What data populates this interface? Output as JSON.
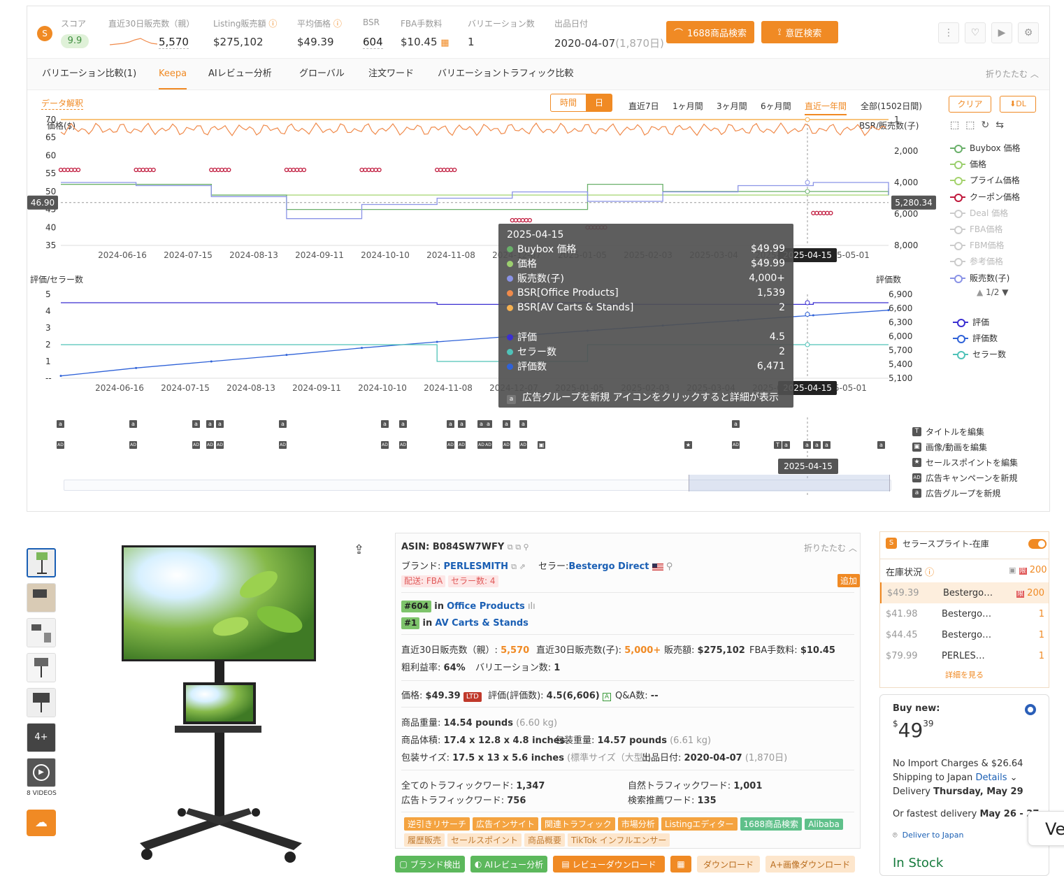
{
  "header": {
    "score_label": "スコア",
    "score_value": "9.9",
    "sales30_label": "直近30日販売数（親）",
    "sales30_value": "5,570",
    "listing_label": "Listing販売額",
    "listing_value": "$275,102",
    "avg_price_label": "平均価格",
    "avg_price_value": "$49.39",
    "bsr_label": "BSR",
    "bsr_value": "604",
    "fba_label": "FBA手数料",
    "fba_value": "$10.45",
    "variation_label": "バリエーション数",
    "variation_value": "1",
    "date_label": "出品日付",
    "date_value": "2020-04-07",
    "date_days": "(1,870日)",
    "btn_1688": "1688商品検索",
    "btn_design": "意匠検索"
  },
  "tabs": [
    "バリエーション比較(1)",
    "Keepa",
    "AIレビュー分析",
    "グローバル",
    "注文ワード",
    "バリエーショントラフィック比較"
  ],
  "collapse_label": "折りたたむ",
  "chart_controls": {
    "data_explain": "データ解釈",
    "time_btn": "時間",
    "day_btn": "日",
    "ranges": [
      "直近7日",
      "1ヶ月間",
      "3ヶ月間",
      "6ヶ月間",
      "直近一年間",
      "全部(1502日間)"
    ],
    "clear_btn": "クリア",
    "dl_btn": "DL"
  },
  "chart_data": [
    {
      "type": "line",
      "ylabel": "価格($)",
      "y2label": "BSR/販売数(子)",
      "ylim": [
        35,
        70
      ],
      "y2lim": [
        8000,
        1
      ],
      "yticks": [
        "70",
        "65",
        "60",
        "55",
        "50",
        "45",
        "40",
        "35"
      ],
      "y2ticks": [
        "1",
        "2,000",
        "4,000",
        "6,000",
        "8,000"
      ],
      "x": [
        "2024-06-16",
        "2024-07-15",
        "2024-08-13",
        "2024-09-11",
        "2024-10-10",
        "2024-11-08",
        "2024-12-07",
        "2025-01-05",
        "2025-02-03",
        "2025-03-04",
        "2025-04-02",
        "2025-05-01"
      ],
      "crosshair_left": "46.90",
      "crosshair_right": "5,280.34",
      "crosshair_date": "2025-04-15",
      "series": [
        {
          "name": "Buybox 価格",
          "values": [
            52,
            52,
            49,
            45,
            45,
            45,
            45,
            52,
            50,
            50,
            50,
            49
          ]
        },
        {
          "name": "価格",
          "values": [
            52,
            52,
            49,
            45,
            45,
            45,
            45,
            52,
            50,
            50,
            50,
            49
          ]
        },
        {
          "name": "プライム価格",
          "values": [
            52,
            52,
            49,
            49,
            49,
            49,
            49,
            49,
            49,
            49,
            49,
            51
          ]
        },
        {
          "name": "クーポン価格",
          "values": [
            56,
            56,
            56,
            56,
            56,
            56,
            42,
            40,
            null,
            null,
            44,
            null
          ]
        },
        {
          "name": "販売数(子)",
          "values": [
            4000,
            4200,
            4900,
            6300,
            5400,
            5000,
            4600,
            5200,
            4600,
            4200,
            4000,
            4800
          ]
        }
      ]
    },
    {
      "type": "line",
      "ylabel": "評価/セラー数",
      "y2label": "評価数",
      "ylim": [
        0,
        5
      ],
      "y2lim": [
        5100,
        6900
      ],
      "yticks": [
        "5",
        "4",
        "3",
        "2",
        "1",
        "--"
      ],
      "y2ticks": [
        "6,900",
        "6,600",
        "6,300",
        "6,000",
        "5,700",
        "5,400",
        "5,100"
      ],
      "x": [
        "2024-06-16",
        "2024-07-15",
        "2024-08-13",
        "2024-09-11",
        "2024-10-10",
        "2024-11-08",
        "2024-12-07",
        "2025-01-05",
        "2025-02-03",
        "2025-03-04",
        "2025-04-02",
        "2025-05-01"
      ],
      "crosshair_date": "2025-04-15",
      "series": [
        {
          "name": "評価",
          "values": [
            4.5,
            4.5,
            4.5,
            4.5,
            4.5,
            4.4,
            4.5,
            4.4,
            4.4,
            4.4,
            4.5,
            4.5
          ]
        },
        {
          "name": "評価数",
          "values": [
            5150,
            5320,
            5460,
            5600,
            5750,
            5880,
            6000,
            6120,
            6230,
            6340,
            6450,
            6560
          ]
        },
        {
          "name": "セラー数",
          "values": [
            2,
            2,
            2,
            2,
            2,
            1,
            1,
            2,
            2,
            2,
            2,
            2
          ]
        }
      ]
    }
  ],
  "legend_top": [
    "Buybox 価格",
    "価格",
    "プライム価格",
    "クーポン価格",
    "Deal 価格",
    "FBA価格",
    "FBM価格",
    "参考価格",
    "販売数(子)"
  ],
  "legend_page": "1/2",
  "legend_bottom": [
    "評価",
    "評価数",
    "セラー数"
  ],
  "legend_colors": {
    "buybox": "#6ab06a",
    "price": "#9ccf6f",
    "prime": "#a5d36e",
    "coupon": "#c0193c",
    "muted": "#cccccc",
    "sales": "#8a93e6",
    "rating": "#3b2fd1",
    "rating_count": "#2f62d8",
    "sellers": "#4fc2b8",
    "bsr": "#f08a4a",
    "bsr2": "#f5b050"
  },
  "tooltip": {
    "date": "2025-04-15",
    "rows": [
      {
        "label": "Buybox 価格",
        "value": "$49.99",
        "color": "#6ab06a"
      },
      {
        "label": "価格",
        "value": "$49.99",
        "color": "#9ccf6f"
      },
      {
        "label": "販売数(子)",
        "value": "4,000+",
        "color": "#8a93e6"
      },
      {
        "label": "BSR[Office Products]",
        "value": "1,539",
        "color": "#f08a4a"
      },
      {
        "label": "BSR[AV Carts & Stands]",
        "value": "2",
        "color": "#f5b050"
      },
      {
        "label": "評価",
        "value": "4.5",
        "color": "#3b2fd1"
      },
      {
        "label": "セラー数",
        "value": "2",
        "color": "#4fc2b8"
      },
      {
        "label": "評価数",
        "value": "6,471",
        "color": "#2f62d8"
      }
    ],
    "footer": "広告グループを新規  アイコンをクリックすると詳細が表示"
  },
  "events_legend": [
    "タイトルを編集",
    "画像/動画を編集",
    "セールスポイントを編集",
    "広告キャンペーンを新規",
    "広告グループを新規"
  ],
  "events_date": "2025-04-15",
  "gallery": {
    "more_label": "4+",
    "videos_label": "8 VIDEOS"
  },
  "product": {
    "asin_label": "ASIN:",
    "asin": "B084SW7WFY",
    "collapse": "折りたたむ",
    "brand_label": "ブランド:",
    "brand": "PERLESMITH",
    "seller_label": "セラー:",
    "seller": "Bestergo Direct",
    "shipping": "配送: FBA",
    "seller_count": "セラー数: 4",
    "add_btn": "追加",
    "rank1_num": "#604",
    "rank1_in": "in",
    "rank1_cat": "Office Products",
    "rank2_num": "#1",
    "rank2_in": "in",
    "rank2_cat": "AV Carts & Stands",
    "s30p_label": "直近30日販売数（親）:",
    "s30p": "5,570",
    "s30c_label": "直近30日販売数(子):",
    "s30c": "5,000+",
    "sales_label": "販売額:",
    "sales": "$275,102",
    "fba_label": "FBA手数料:",
    "fba": "$10.45",
    "margin_label": "粗利益率:",
    "margin": "64%",
    "var_label": "バリエーション数:",
    "var": "1",
    "price_label": "価格:",
    "price": "$49.39",
    "ltd": "LTD",
    "rating_label": "評価(評価数):",
    "rating": "4.5(6,606)",
    "rating_tag": "A",
    "qa_label": "Q&A数:",
    "qa": "--",
    "weight_label": "商品重量:",
    "weight": "14.54 pounds",
    "weight_kg": "(6.60 kg)",
    "dim_label": "商品体積:",
    "dim": "17.4 x 12.8 x 4.8 inches",
    "pkg_w_label": "包装重量:",
    "pkg_w": "14.57 pounds",
    "pkg_w_kg": "(6.61 kg)",
    "pkg_size_label": "包装サイズ:",
    "pkg_size": "17.5 x 13 x 5.6 inches",
    "pkg_size_class": "(標準サイズ（大型）)",
    "list_date_label": "出品日付:",
    "list_date": "2020-04-07",
    "list_date_days": "(1,870日)",
    "traffic_all_label": "全てのトラフィックワード:",
    "traffic_all": "1,347",
    "traffic_nat_label": "自然トラフィックワード:",
    "traffic_nat": "1,001",
    "traffic_ad_label": "広告トラフィックワード:",
    "traffic_ad": "756",
    "traffic_rec_label": "検索推薦ワード:",
    "traffic_rec": "135",
    "tags1": [
      "逆引きリサーチ",
      "広告インサイト",
      "関連トラフィック",
      "市場分析",
      "Listingエディター"
    ],
    "tags1_green": [
      "1688商品検索",
      "Alibaba"
    ],
    "tags2": [
      "履歴販売",
      "セールスポイント",
      "商品概要",
      "TikTok インフルエンサー"
    ]
  },
  "bottom_buttons": [
    "ブランド検出",
    "AIレビュー分析",
    "レビューダウンロード",
    "",
    "ダウンロード",
    "A+画像ダウンロード"
  ],
  "inventory": {
    "title": "セラースプライト-在庫",
    "status_label": "在庫状況",
    "total": "200",
    "rows": [
      {
        "price": "$49.39",
        "seller": "Bestergo…",
        "qty": "200"
      },
      {
        "price": "$41.98",
        "seller": "Bestergo…",
        "qty": "1"
      },
      {
        "price": "$44.45",
        "seller": "Bestergo…",
        "qty": "1"
      },
      {
        "price": "$79.99",
        "seller": "PERLES…",
        "qty": "1"
      }
    ],
    "more": "詳細を見る"
  },
  "amazon": {
    "buy_new": "Buy new:",
    "currency": "$",
    "whole": "49",
    "fraction": "39",
    "import_line": "No Import Charges & $26.64",
    "ship_line": "Shipping to Japan",
    "details": "Details",
    "delivery_prefix": "Delivery",
    "delivery_date": "Thursday, May 29",
    "fastest_prefix": "Or fastest delivery",
    "fastest_date": "May 26 - 27",
    "deliver_to": "Deliver to Japan",
    "stock": "In Stock"
  },
  "floating_label": "Ve"
}
